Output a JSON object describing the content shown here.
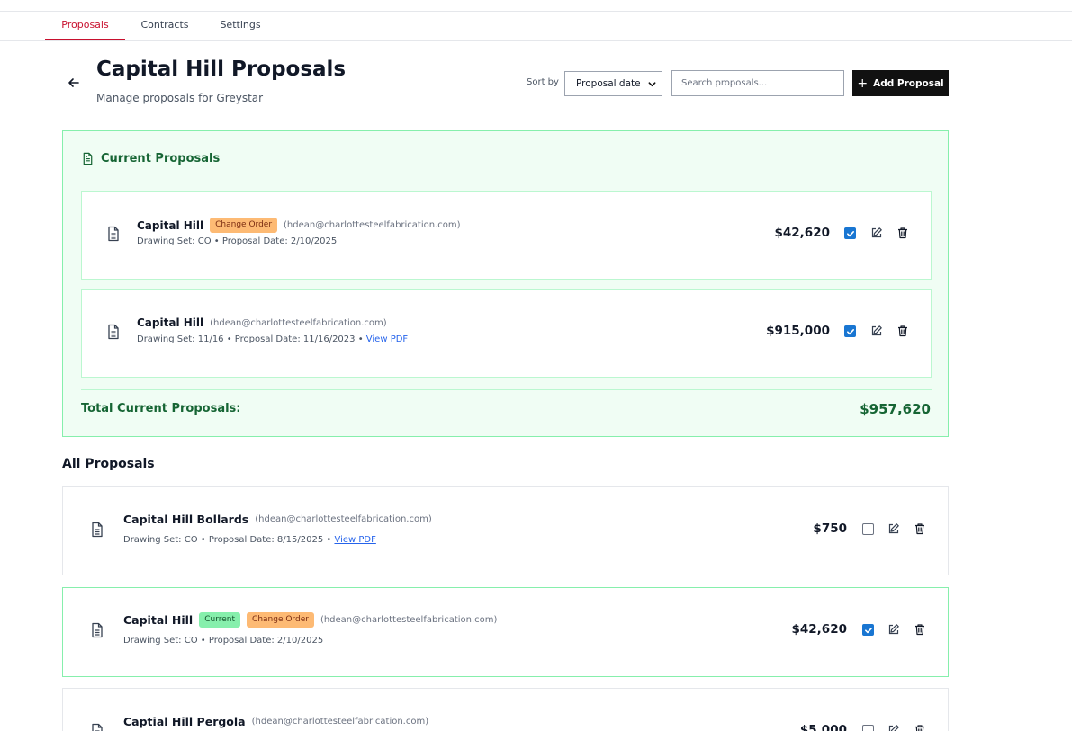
{
  "nav": {
    "tabs": [
      {
        "label": "Proposals",
        "active": true
      },
      {
        "label": "Contracts",
        "active": false
      },
      {
        "label": "Settings",
        "active": false
      }
    ]
  },
  "header": {
    "title": "Capital Hill Proposals",
    "subtitle": "Manage proposals for Greystar",
    "sort_label": "Sort by",
    "sort_value": "Proposal date",
    "search_placeholder": "Search proposals...",
    "add_button_label": "Add Proposal"
  },
  "current": {
    "title": "Current Proposals",
    "total_label": "Total Current Proposals:",
    "total_amount": "$957,620",
    "items": [
      {
        "name": "Capital Hill",
        "badge": "Change Order",
        "email": "(hdean@charlottesteelfabrication.com)",
        "meta": "Drawing Set: CO • Proposal Date: 2/10/2025",
        "link": "",
        "amount": "$42,620",
        "checked": true
      },
      {
        "name": "Capital Hill",
        "badge": "",
        "email": "(hdean@charlottesteelfabrication.com)",
        "meta": "Drawing Set: 11/16 • Proposal Date: 11/16/2023 • ",
        "link": "View PDF",
        "amount": "$915,000",
        "checked": true
      }
    ]
  },
  "all": {
    "title": "All Proposals",
    "items": [
      {
        "name": "Capital Hill Bollards",
        "email": "(hdean@charlottesteelfabrication.com)",
        "meta": "Drawing Set: CO • Proposal Date: 8/15/2025 • ",
        "link": "View PDF",
        "amount": "$750",
        "checked": false
      },
      {
        "name": "Capital Hill",
        "badge_current": "Current",
        "badge_co": "Change Order",
        "email": "(hdean@charlottesteelfabrication.com)",
        "meta": "Drawing Set: CO • Proposal Date: 2/10/2025",
        "amount": "$42,620",
        "checked": true
      },
      {
        "name": "Captial Hill Pergola",
        "email": "(hdean@charlottesteelfabrication.com)",
        "amount": "$5,000",
        "checked": false
      }
    ]
  },
  "colors": {
    "accent": "#c8102e",
    "green_text": "#166534",
    "green_bg": "#f0fdf4",
    "green_border": "#86efac",
    "checkbox_blue": "#1976d2",
    "badge_orange": "#fdba74",
    "badge_green": "#86efac"
  },
  "icons": [
    "arrow-left-icon",
    "chevron-down-icon",
    "plus-icon",
    "document-icon",
    "checkmark-icon",
    "edit-icon",
    "trash-icon"
  ]
}
